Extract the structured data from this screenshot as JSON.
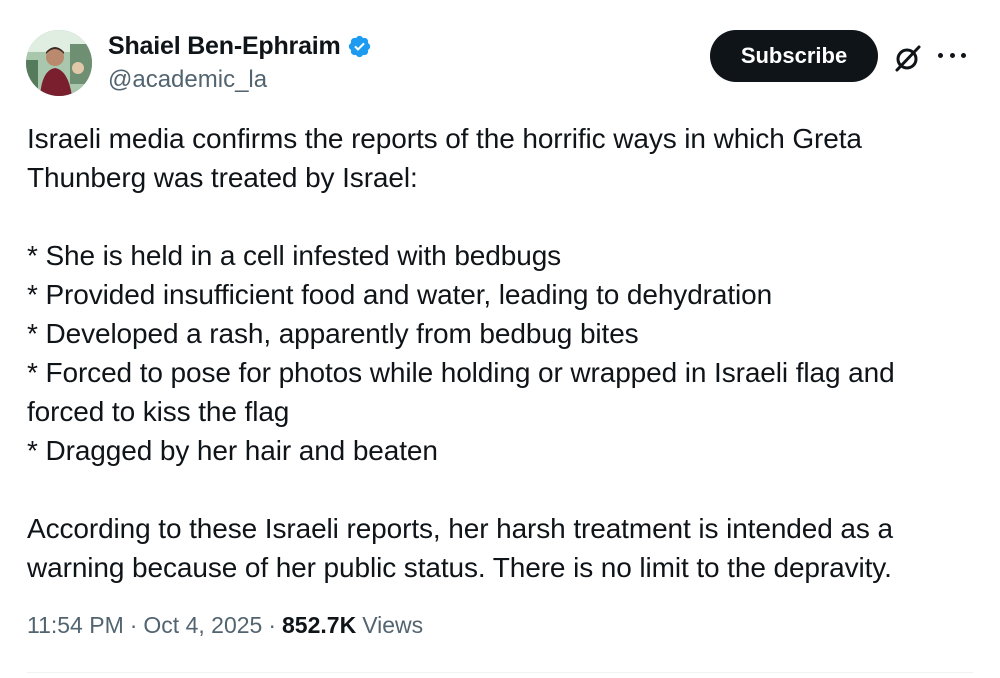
{
  "author": {
    "name": "Shaiel Ben-Ephraim",
    "handle": "@academic_la",
    "verified": true
  },
  "actions": {
    "subscribe_label": "Subscribe",
    "grok_icon": "grok-icon",
    "more_icon": "more-options-icon"
  },
  "post": {
    "intro": "Israeli media confirms the reports of the horrific ways in which Greta Thunberg was treated by Israel:",
    "bullets": [
      "* She is held in a cell infested with bedbugs",
      "* Provided insufficient food and water, leading to dehydration",
      "* Developed a rash, apparently from bedbug bites",
      "* Forced to pose for photos while holding or wrapped in Israeli flag and forced to kiss the flag",
      "* Dragged by her hair and beaten"
    ],
    "conclusion": "According to these Israeli reports, her harsh treatment is intended as a warning because of her public status. There is no limit to the depravity."
  },
  "meta": {
    "time": "11:54 PM",
    "separator": "·",
    "date": "Oct 4, 2025",
    "views_count": "852.7K",
    "views_label": "Views"
  },
  "colors": {
    "text": "#0f1419",
    "secondary": "#536471",
    "verified_blue": "#1d9bf0",
    "button_bg": "#0f1419"
  }
}
